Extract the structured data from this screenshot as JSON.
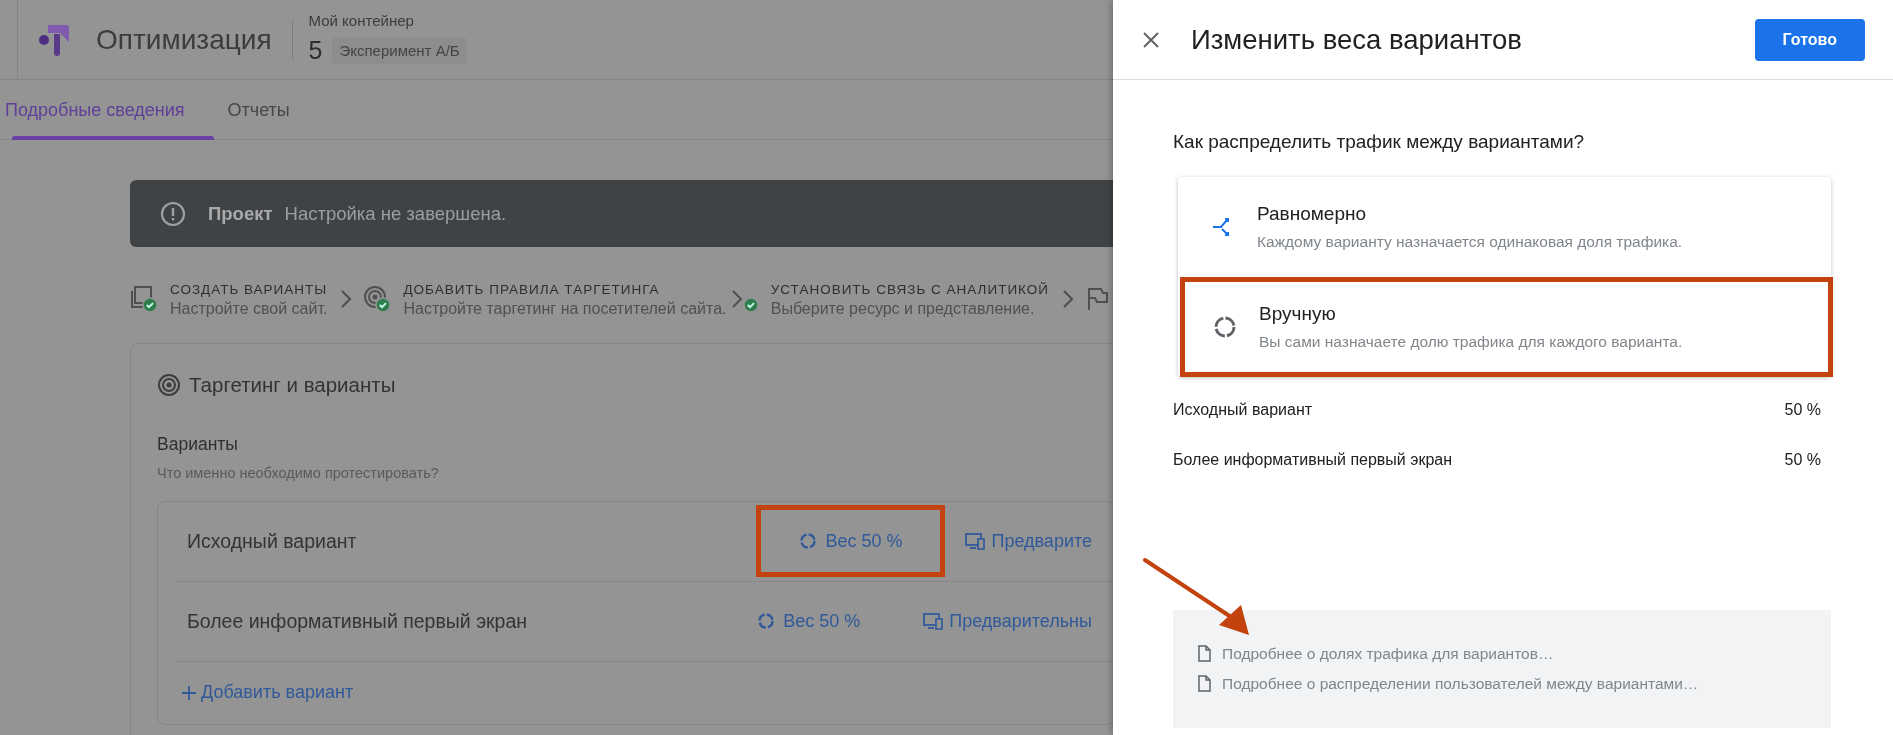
{
  "app": {
    "title": "Оптимизация",
    "container_label": "Мой контейнер",
    "experiment_number": "5",
    "experiment_type": "Эксперимент А/Б"
  },
  "tabs": [
    {
      "label": "Подробные сведения",
      "selected": true
    },
    {
      "label": "Отчеты",
      "selected": false
    }
  ],
  "banner": {
    "title": "Проект",
    "message": "Настройка не завершена."
  },
  "steps": [
    {
      "kind": "variants",
      "title": "СОЗДАТЬ ВАРИАНТЫ",
      "subtitle": "Настройте свой сайт.",
      "done": true
    },
    {
      "kind": "targeting",
      "title": "ДОБАВИТЬ ПРАВИЛА ТАРГЕТИНГА",
      "subtitle": "Настройте таргетинг на посетителей сайта.",
      "done": true
    },
    {
      "kind": "analytics",
      "title": "УСТАНОВИТЬ СВЯЗЬ С АНАЛИТИКОЙ",
      "subtitle": "Выберите ресурс и представление.",
      "done": true
    },
    {
      "kind": "flag"
    }
  ],
  "card": {
    "title": "Таргетинг и варианты",
    "section": "Варианты",
    "hint": "Что именно необходимо протестировать?",
    "variants": [
      {
        "name": "Исходный вариант",
        "weight": "Вес 50 %",
        "preview": "Предварите",
        "highlighted": true
      },
      {
        "name": "Более информативный первый экран",
        "weight": "Вес 50 %",
        "preview": "Предварительны",
        "highlighted": false
      }
    ],
    "add_label": "Добавить вариант"
  },
  "panel": {
    "title": "Изменить веса вариантов",
    "done_button": "Готово",
    "question": "Как распределить трафик между вариантами?",
    "options": [
      {
        "kind": "even",
        "label": "Равномерно",
        "description": "Каждому варианту назначается одинаковая доля трафика.",
        "highlighted": false
      },
      {
        "kind": "manual",
        "label": "Вручную",
        "description": "Вы сами назначаете долю трафика для каждого варианта.",
        "highlighted": true
      }
    ],
    "weights": [
      {
        "name": "Исходный вариант",
        "value": "50 %"
      },
      {
        "name": "Более информативный первый экран",
        "value": "50 %"
      }
    ],
    "info": {
      "arrow": true,
      "links": [
        {
          "prefix": "Подробнее",
          "link": "о долях трафика для вариантов",
          "suffix": "…"
        },
        {
          "prefix": "Подробнее",
          "link": "о распределении пользователей между вариантами",
          "suffix": "…"
        }
      ]
    }
  }
}
